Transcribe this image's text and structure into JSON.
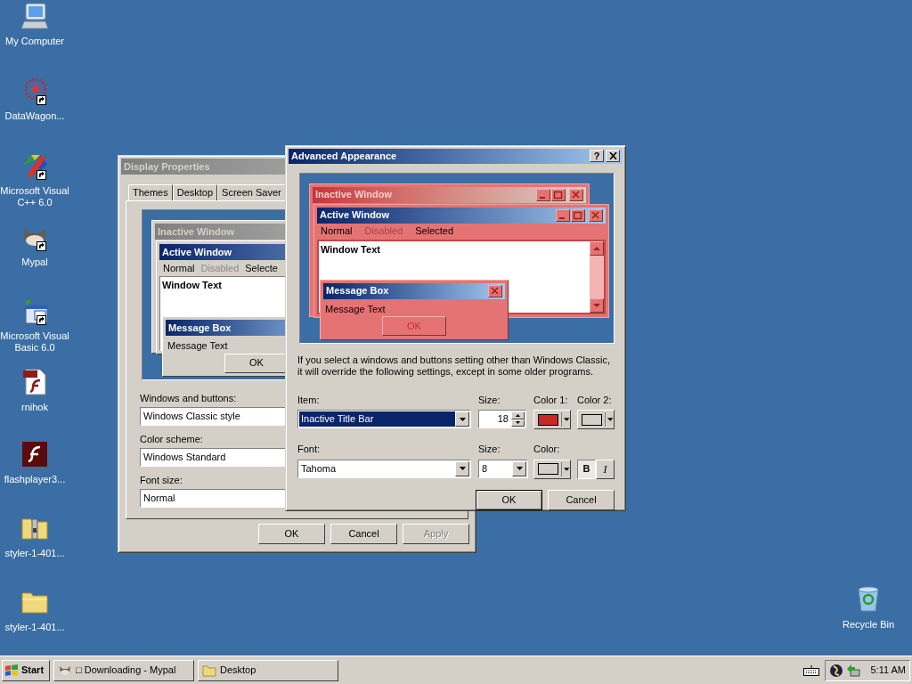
{
  "desktop": {
    "icons": [
      {
        "label": "My Computer",
        "shortcut": false
      },
      {
        "label": "DataWagon...",
        "shortcut": true
      },
      {
        "label": "Microsoft Visual C++ 6.0",
        "shortcut": true
      },
      {
        "label": "Mypal",
        "shortcut": true
      },
      {
        "label": "Microsoft Visual Basic 6.0",
        "shortcut": true
      },
      {
        "label": "rnihok",
        "shortcut": false
      },
      {
        "label": "flashplayer3...",
        "shortcut": false
      },
      {
        "label": "styler-1-401...",
        "shortcut": false
      },
      {
        "label": "styler-1-401...",
        "shortcut": false
      }
    ],
    "recycle_bin": {
      "label": "Recycle Bin"
    }
  },
  "display_properties": {
    "title": "Display Properties",
    "active": false,
    "tabs": [
      {
        "label": "Themes",
        "selected": false
      },
      {
        "label": "Desktop",
        "selected": false
      },
      {
        "label": "Screen Saver",
        "selected": false
      }
    ],
    "preview": {
      "inactive_title": "Inactive Window",
      "active_title": "Active Window",
      "menu": [
        {
          "label": "Normal",
          "disabled": false
        },
        {
          "label": "Disabled",
          "disabled": true
        },
        {
          "label": "Selecte",
          "disabled": false
        }
      ],
      "window_text": "Window Text",
      "message_title": "Message Box",
      "message_text": "Message Text",
      "ok": "OK"
    },
    "fields": [
      {
        "label": "Windows and buttons:",
        "value": "Windows Classic style"
      },
      {
        "label": "Color scheme:",
        "value": "Windows Standard"
      },
      {
        "label": "Font size:",
        "value": "Normal"
      }
    ],
    "buttons": [
      {
        "label": "OK",
        "disabled": false
      },
      {
        "label": "Cancel",
        "disabled": false
      },
      {
        "label": "Apply",
        "disabled": true
      }
    ]
  },
  "advanced_appearance": {
    "title": "Advanced Appearance",
    "active": true,
    "help": "?",
    "preview": {
      "inactive_title": "Inactive Window",
      "active_title": "Active Window",
      "menu": [
        {
          "label": "Normal",
          "disabled": false
        },
        {
          "label": "Disabled",
          "disabled": true
        },
        {
          "label": "Selected",
          "disabled": false
        }
      ],
      "window_text": "Window Text",
      "message_title": "Message Box",
      "message_text": "Message Text",
      "ok": "OK"
    },
    "note": "If you select a windows and buttons setting other than Windows Classic, it will override the following settings, except in some older programs.",
    "item": {
      "label": "Item:",
      "value": "Inactive Title Bar"
    },
    "item_size": {
      "label": "Size:",
      "value": "18"
    },
    "color1": {
      "label": "Color 1:",
      "color": "#c82828"
    },
    "color2": {
      "label": "Color 2:",
      "color": "#d4d0c8"
    },
    "font": {
      "label": "Font:",
      "value": "Tahoma"
    },
    "font_size": {
      "label": "Size:",
      "value": "8"
    },
    "font_color": {
      "label": "Color:",
      "color": "#d4d0c8"
    },
    "bold": {
      "label": "B",
      "on": true
    },
    "italic": {
      "label": "I",
      "on": false
    },
    "buttons": [
      {
        "label": "OK",
        "default": true
      },
      {
        "label": "Cancel",
        "default": false
      }
    ]
  },
  "taskbar": {
    "start": "Start",
    "tasks": [
      {
        "label": "□ Downloading - Mypal",
        "selected": false
      },
      {
        "label": "Desktop",
        "selected": false
      }
    ],
    "clock": "5:11 AM"
  }
}
